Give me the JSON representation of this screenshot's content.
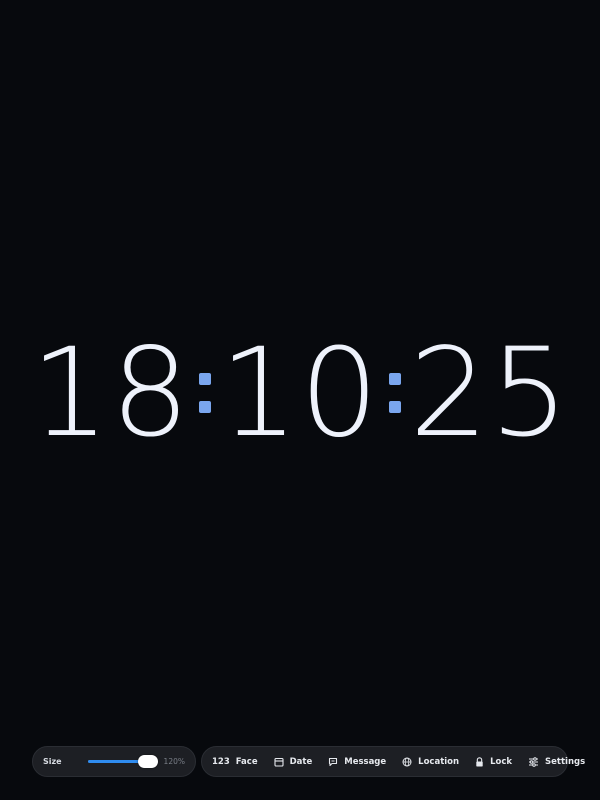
{
  "clock": {
    "hours": "18",
    "minutes": "10",
    "seconds": "25",
    "separator_color": "#7aa6ee"
  },
  "size_control": {
    "label": "Size",
    "value_text": "120%",
    "slider_fraction": 0.85,
    "accent_color": "#2f8cf0"
  },
  "toolbar": {
    "face": {
      "icon_text": "123",
      "label": "Face",
      "icon": "number-icon"
    },
    "date": {
      "label": "Date",
      "icon": "calendar-icon"
    },
    "message": {
      "label": "Message",
      "icon": "chat-bubble-icon"
    },
    "location": {
      "label": "Location",
      "icon": "globe-icon"
    },
    "lock": {
      "label": "Lock",
      "icon": "lock-icon"
    },
    "settings": {
      "label": "Settings",
      "icon": "sliders-icon"
    }
  }
}
